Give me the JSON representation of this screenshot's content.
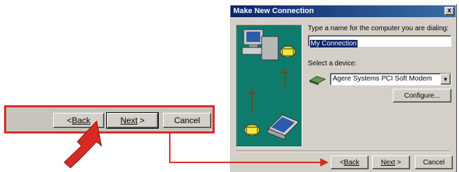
{
  "zoom": {
    "back_label": "Back",
    "next_label": "Next",
    "cancel_label": "Cancel"
  },
  "dialog": {
    "title": "Make New Connection",
    "close_label": "x",
    "name_prompt": "Type a name for the computer you are dialing:",
    "name_value": "My Connection",
    "device_prompt": "Select a device:",
    "device_value": "Agere Systems PCI Soft Modem",
    "configure_label": "Configure...",
    "back_label": "Back",
    "next_label": "Next",
    "cancel_label": "Cancel"
  },
  "colors": {
    "highlight_red": "#d62a22",
    "illustration_teal": "#0f7b6c",
    "dialog_gray": "#d4d0c8",
    "titlebar_blue": "#0a246a"
  }
}
